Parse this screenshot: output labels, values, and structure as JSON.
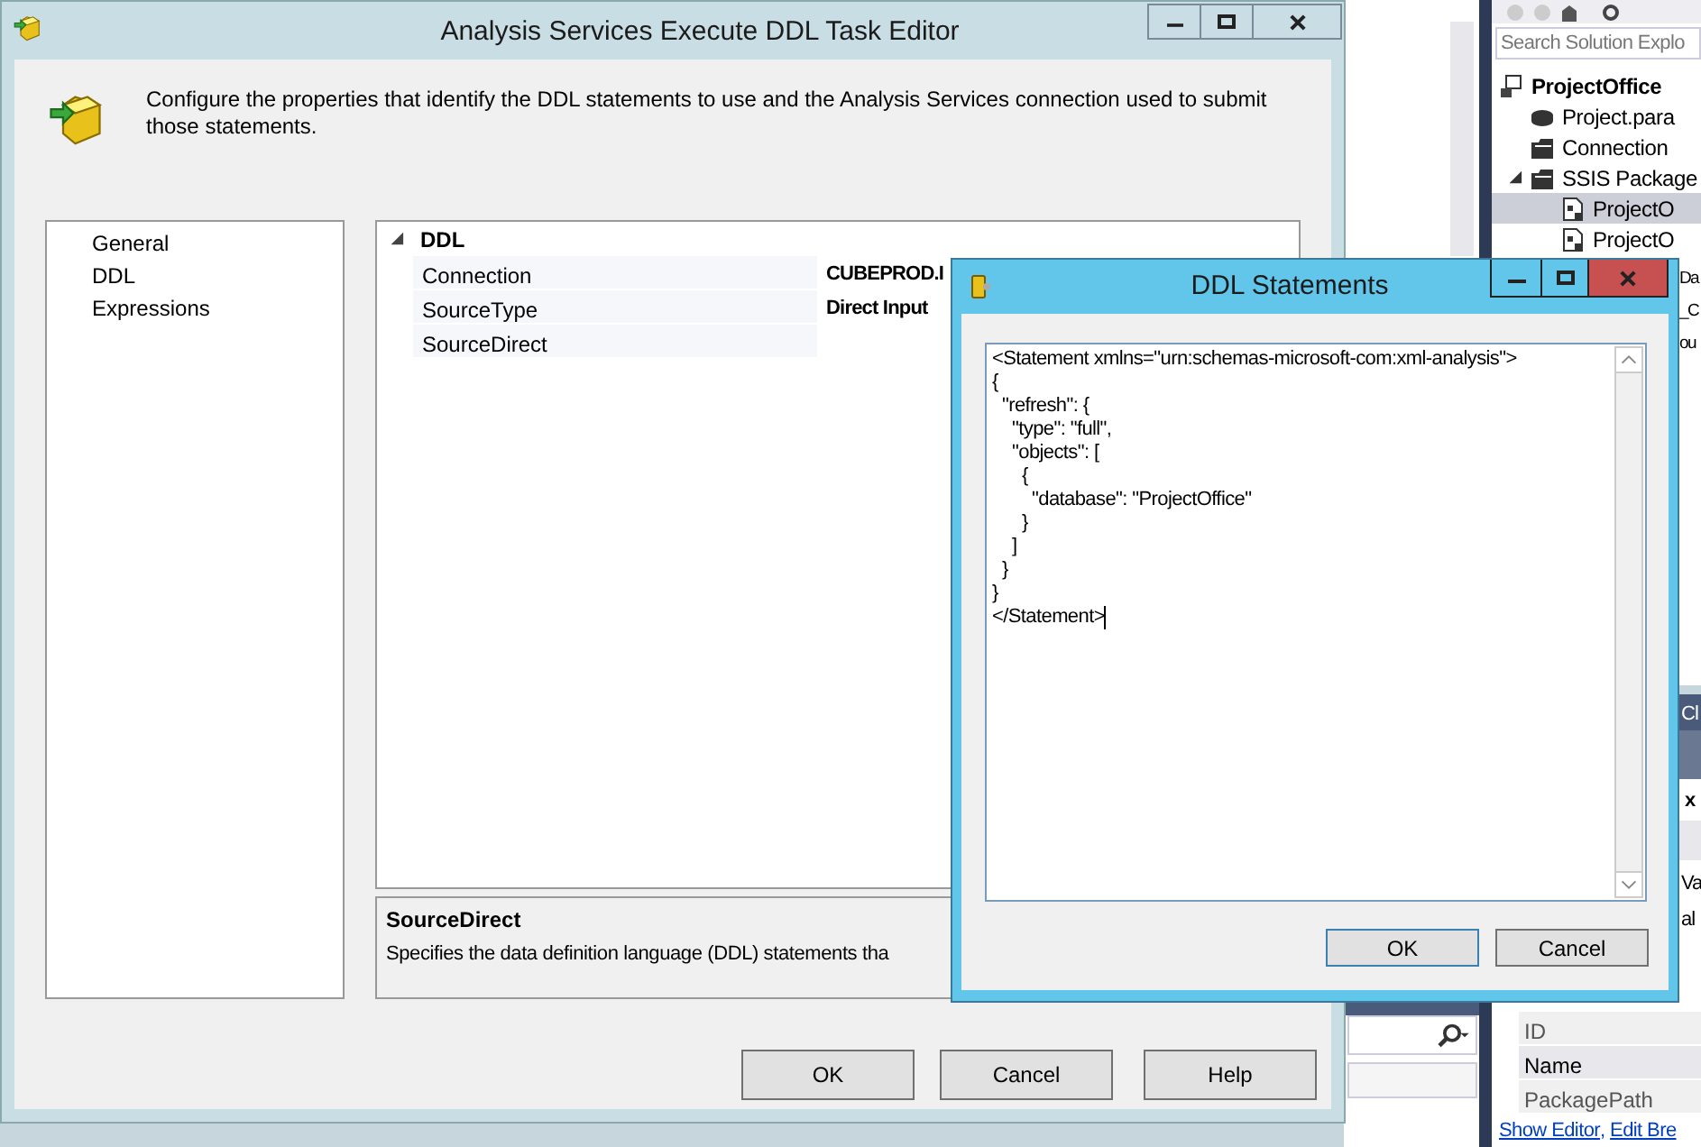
{
  "editor": {
    "title": "Analysis Services Execute DDL Task Editor",
    "header_text": "Configure the properties that identify the DDL statements to use and the Analysis Services connection used to submit those statements.",
    "pages": [
      {
        "label": "General"
      },
      {
        "label": "DDL"
      },
      {
        "label": "Expressions"
      }
    ],
    "grid": {
      "category": "DDL",
      "expanded": true,
      "rows": [
        {
          "name": "Connection",
          "value": "CUBEPROD.I"
        },
        {
          "name": "SourceType",
          "value": "Direct Input"
        },
        {
          "name": "SourceDirect",
          "value": ""
        }
      ]
    },
    "description": {
      "title": "SourceDirect",
      "text": "Specifies the data definition language (DDL) statements tha"
    },
    "buttons": [
      "OK",
      "Cancel",
      "Help"
    ]
  },
  "ddl_dialog": {
    "title": "DDL Statements",
    "statement": "<Statement xmlns=\"urn:schemas-microsoft-com:xml-analysis\">\n{\n  \"refresh\": {\n    \"type\": \"full\",\n    \"objects\": [\n      {\n        \"database\": \"ProjectOffice\"\n      }\n    ]\n  }\n}\n</Statement>",
    "buttons": [
      "OK",
      "Cancel"
    ]
  },
  "solution_explorer": {
    "search_placeholder": "Search Solution Explo",
    "items": [
      {
        "label": "ProjectOffice",
        "kind": "project",
        "children": [
          {
            "label": "Project.para",
            "kind": "params"
          },
          {
            "label": "Connection",
            "kind": "folder"
          },
          {
            "label": "SSIS Package",
            "kind": "folder",
            "expanded": true,
            "children": [
              {
                "label": "ProjectO",
                "kind": "package",
                "selected": true
              },
              {
                "label": "ProjectO",
                "kind": "package",
                "selected": false
              }
            ]
          }
        ]
      }
    ]
  },
  "panel_fragments": [
    "Da",
    "_C",
    "ou"
  ],
  "properties": {
    "header": "Cl",
    "object": "x",
    "fragments": [
      "Va",
      "al"
    ],
    "rows": [
      "ID",
      "Name",
      "PackagePath"
    ],
    "links": [
      "Show Editor",
      ", ",
      "Edit Bre"
    ]
  }
}
